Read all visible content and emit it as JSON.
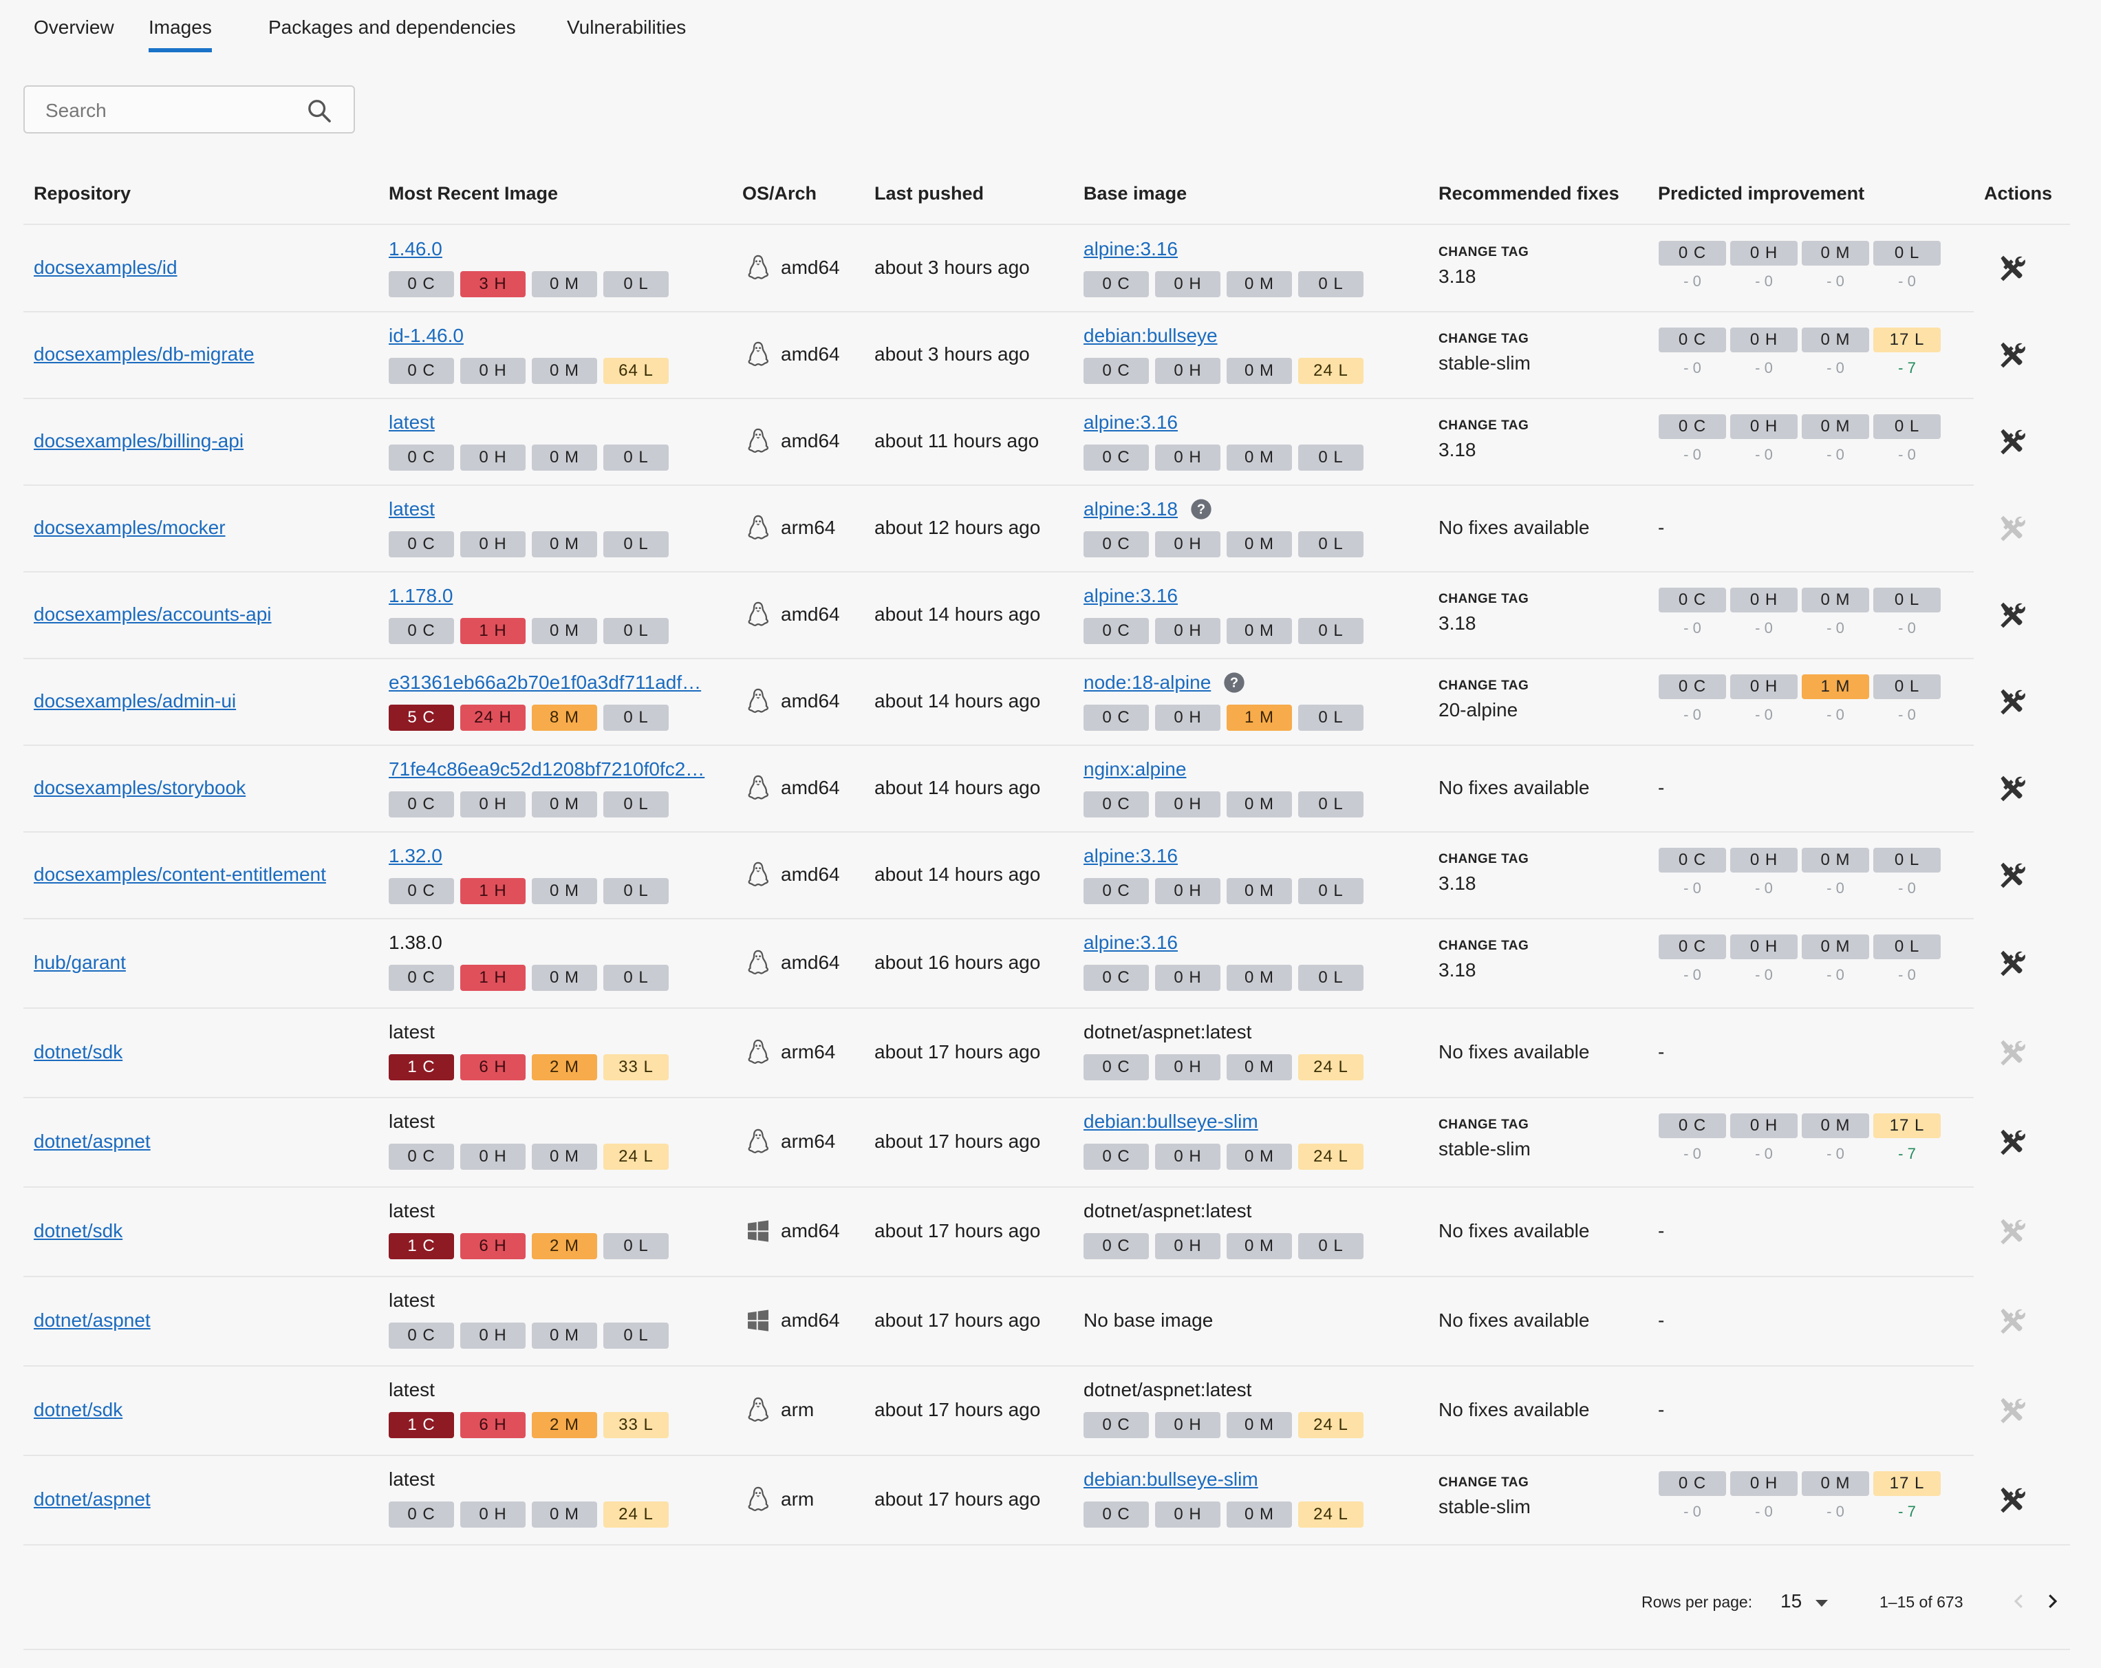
{
  "tabs": [
    "Overview",
    "Images",
    "Packages and dependencies",
    "Vulnerabilities"
  ],
  "active_tab": "Images",
  "search": {
    "placeholder": "Search",
    "value": ""
  },
  "columns": [
    "Repository",
    "Most Recent Image",
    "OS/Arch",
    "Last pushed",
    "Base image",
    "Recommended fixes",
    "Predicted improvement",
    "Actions"
  ],
  "fix_label": "CHANGE TAG",
  "no_fixes_text": "No fixes available",
  "no_improvement_text": "-",
  "colors": {
    "link": "#1a6bbf",
    "critical": "#8e1a24",
    "high": "#e0505b",
    "medium": "#f7ab4a",
    "low": "#fde1a6",
    "neutral": "#c9cbd2",
    "accent": "#1a73c8"
  },
  "rows": [
    {
      "repo": "docsexamples/id",
      "image_tag": "1.46.0",
      "image_link": true,
      "image_vulns": [
        "0 C",
        "3 H",
        "0 M",
        "0 L"
      ],
      "os": "linux",
      "arch": "amd64",
      "pushed": "about 3 hours ago",
      "base": "alpine:3.16",
      "base_link": true,
      "base_help": false,
      "base_vulns": [
        "0 C",
        "0 H",
        "0 M",
        "0 L"
      ],
      "fix": "3.18",
      "pred": [
        "0 C",
        "0 H",
        "0 M",
        "0 L"
      ],
      "pred_delta": [
        "- 0",
        "- 0",
        "- 0",
        "- 0"
      ],
      "action_enabled": true
    },
    {
      "repo": "docsexamples/db-migrate",
      "image_tag": "id-1.46.0",
      "image_link": true,
      "image_vulns": [
        "0 C",
        "0 H",
        "0 M",
        "64 L"
      ],
      "os": "linux",
      "arch": "amd64",
      "pushed": "about 3 hours ago",
      "base": "debian:bullseye",
      "base_link": true,
      "base_help": false,
      "base_vulns": [
        "0 C",
        "0 H",
        "0 M",
        "24 L"
      ],
      "fix": "stable-slim",
      "pred": [
        "0 C",
        "0 H",
        "0 M",
        "17 L"
      ],
      "pred_delta": [
        "- 0",
        "- 0",
        "- 0",
        "- 7"
      ],
      "action_enabled": true
    },
    {
      "repo": "docsexamples/billing-api",
      "image_tag": "latest",
      "image_link": true,
      "image_vulns": [
        "0 C",
        "0 H",
        "0 M",
        "0 L"
      ],
      "os": "linux",
      "arch": "amd64",
      "pushed": "about 11 hours ago",
      "base": "alpine:3.16",
      "base_link": true,
      "base_help": false,
      "base_vulns": [
        "0 C",
        "0 H",
        "0 M",
        "0 L"
      ],
      "fix": "3.18",
      "pred": [
        "0 C",
        "0 H",
        "0 M",
        "0 L"
      ],
      "pred_delta": [
        "- 0",
        "- 0",
        "- 0",
        "- 0"
      ],
      "action_enabled": true
    },
    {
      "repo": "docsexamples/mocker",
      "image_tag": "latest",
      "image_link": true,
      "image_vulns": [
        "0 C",
        "0 H",
        "0 M",
        "0 L"
      ],
      "os": "linux",
      "arch": "arm64",
      "pushed": "about 12 hours ago",
      "base": "alpine:3.18",
      "base_link": true,
      "base_help": true,
      "base_vulns": [
        "0 C",
        "0 H",
        "0 M",
        "0 L"
      ],
      "fix": null,
      "pred": null,
      "pred_delta": null,
      "action_enabled": false
    },
    {
      "repo": "docsexamples/accounts-api",
      "image_tag": "1.178.0",
      "image_link": true,
      "image_vulns": [
        "0 C",
        "1 H",
        "0 M",
        "0 L"
      ],
      "os": "linux",
      "arch": "amd64",
      "pushed": "about 14 hours ago",
      "base": "alpine:3.16",
      "base_link": true,
      "base_help": false,
      "base_vulns": [
        "0 C",
        "0 H",
        "0 M",
        "0 L"
      ],
      "fix": "3.18",
      "pred": [
        "0 C",
        "0 H",
        "0 M",
        "0 L"
      ],
      "pred_delta": [
        "- 0",
        "- 0",
        "- 0",
        "- 0"
      ],
      "action_enabled": true
    },
    {
      "repo": "docsexamples/admin-ui",
      "image_tag": "e31361eb66a2b70e1f0a3df711adf…",
      "image_link": true,
      "image_vulns": [
        "5 C",
        "24 H",
        "8 M",
        "0 L"
      ],
      "os": "linux",
      "arch": "amd64",
      "pushed": "about 14 hours ago",
      "base": "node:18-alpine",
      "base_link": true,
      "base_help": true,
      "base_vulns": [
        "0 C",
        "0 H",
        "1 M",
        "0 L"
      ],
      "fix": "20-alpine",
      "pred": [
        "0 C",
        "0 H",
        "1 M",
        "0 L"
      ],
      "pred_delta": [
        "- 0",
        "- 0",
        "- 0",
        "- 0"
      ],
      "action_enabled": true
    },
    {
      "repo": "docsexamples/storybook",
      "image_tag": "71fe4c86ea9c52d1208bf7210f0fc2…",
      "image_link": true,
      "image_vulns": [
        "0 C",
        "0 H",
        "0 M",
        "0 L"
      ],
      "os": "linux",
      "arch": "amd64",
      "pushed": "about 14 hours ago",
      "base": "nginx:alpine",
      "base_link": true,
      "base_help": false,
      "base_vulns": [
        "0 C",
        "0 H",
        "0 M",
        "0 L"
      ],
      "fix": null,
      "pred": null,
      "pred_delta": null,
      "action_enabled": true
    },
    {
      "repo": "docsexamples/content-entitlement",
      "image_tag": "1.32.0",
      "image_link": true,
      "image_vulns": [
        "0 C",
        "1 H",
        "0 M",
        "0 L"
      ],
      "os": "linux",
      "arch": "amd64",
      "pushed": "about 14 hours ago",
      "base": "alpine:3.16",
      "base_link": true,
      "base_help": false,
      "base_vulns": [
        "0 C",
        "0 H",
        "0 M",
        "0 L"
      ],
      "fix": "3.18",
      "pred": [
        "0 C",
        "0 H",
        "0 M",
        "0 L"
      ],
      "pred_delta": [
        "- 0",
        "- 0",
        "- 0",
        "- 0"
      ],
      "action_enabled": true
    },
    {
      "repo": "hub/garant",
      "image_tag": "1.38.0",
      "image_link": false,
      "image_vulns": [
        "0 C",
        "1 H",
        "0 M",
        "0 L"
      ],
      "os": "linux",
      "arch": "amd64",
      "pushed": "about 16 hours ago",
      "base": "alpine:3.16",
      "base_link": true,
      "base_help": false,
      "base_vulns": [
        "0 C",
        "0 H",
        "0 M",
        "0 L"
      ],
      "fix": "3.18",
      "pred": [
        "0 C",
        "0 H",
        "0 M",
        "0 L"
      ],
      "pred_delta": [
        "- 0",
        "- 0",
        "- 0",
        "- 0"
      ],
      "action_enabled": true
    },
    {
      "repo": "dotnet/sdk",
      "image_tag": "latest",
      "image_link": false,
      "image_vulns": [
        "1 C",
        "6 H",
        "2 M",
        "33 L"
      ],
      "os": "linux",
      "arch": "arm64",
      "pushed": "about 17 hours ago",
      "base": "dotnet/aspnet:latest",
      "base_link": false,
      "base_help": false,
      "base_vulns": [
        "0 C",
        "0 H",
        "0 M",
        "24 L"
      ],
      "fix": null,
      "pred": null,
      "pred_delta": null,
      "action_enabled": false
    },
    {
      "repo": "dotnet/aspnet",
      "image_tag": "latest",
      "image_link": false,
      "image_vulns": [
        "0 C",
        "0 H",
        "0 M",
        "24 L"
      ],
      "os": "linux",
      "arch": "arm64",
      "pushed": "about 17 hours ago",
      "base": "debian:bullseye-slim",
      "base_link": true,
      "base_help": false,
      "base_vulns": [
        "0 C",
        "0 H",
        "0 M",
        "24 L"
      ],
      "fix": "stable-slim",
      "pred": [
        "0 C",
        "0 H",
        "0 M",
        "17 L"
      ],
      "pred_delta": [
        "- 0",
        "- 0",
        "- 0",
        "- 7"
      ],
      "action_enabled": true
    },
    {
      "repo": "dotnet/sdk",
      "image_tag": "latest",
      "image_link": false,
      "image_vulns": [
        "1 C",
        "6 H",
        "2 M",
        "0 L"
      ],
      "os": "windows",
      "arch": "amd64",
      "pushed": "about 17 hours ago",
      "base": "dotnet/aspnet:latest",
      "base_link": false,
      "base_help": false,
      "base_vulns": [
        "0 C",
        "0 H",
        "0 M",
        "0 L"
      ],
      "fix": null,
      "pred": null,
      "pred_delta": null,
      "action_enabled": false
    },
    {
      "repo": "dotnet/aspnet",
      "image_tag": "latest",
      "image_link": false,
      "image_vulns": [
        "0 C",
        "0 H",
        "0 M",
        "0 L"
      ],
      "os": "windows",
      "arch": "amd64",
      "pushed": "about 17 hours ago",
      "base": "No base image",
      "base_link": false,
      "base_help": false,
      "base_vulns": null,
      "fix": null,
      "pred": null,
      "pred_delta": null,
      "action_enabled": false
    },
    {
      "repo": "dotnet/sdk",
      "image_tag": "latest",
      "image_link": false,
      "image_vulns": [
        "1 C",
        "6 H",
        "2 M",
        "33 L"
      ],
      "os": "linux",
      "arch": "arm",
      "pushed": "about 17 hours ago",
      "base": "dotnet/aspnet:latest",
      "base_link": false,
      "base_help": false,
      "base_vulns": [
        "0 C",
        "0 H",
        "0 M",
        "24 L"
      ],
      "fix": null,
      "pred": null,
      "pred_delta": null,
      "action_enabled": false
    },
    {
      "repo": "dotnet/aspnet",
      "image_tag": "latest",
      "image_link": false,
      "image_vulns": [
        "0 C",
        "0 H",
        "0 M",
        "24 L"
      ],
      "os": "linux",
      "arch": "arm",
      "pushed": "about 17 hours ago",
      "base": "debian:bullseye-slim",
      "base_link": true,
      "base_help": false,
      "base_vulns": [
        "0 C",
        "0 H",
        "0 M",
        "24 L"
      ],
      "fix": "stable-slim",
      "pred": [
        "0 C",
        "0 H",
        "0 M",
        "17 L"
      ],
      "pred_delta": [
        "- 0",
        "- 0",
        "- 0",
        "- 7"
      ],
      "action_enabled": true
    }
  ],
  "pagination": {
    "rows_per_page_label": "Rows per page:",
    "rows_per_page": "15",
    "range": "1–15 of 673"
  }
}
